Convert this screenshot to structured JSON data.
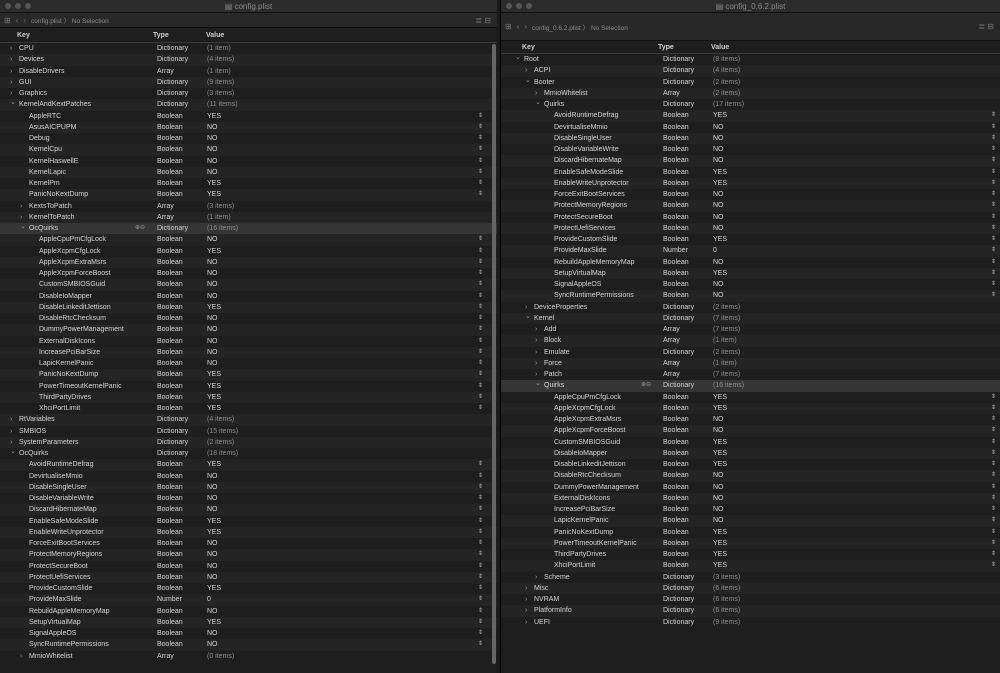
{
  "left": {
    "title": "config.plist",
    "path": "config.plist",
    "selection": "No Selection",
    "cols": {
      "key": "Key",
      "type": "Type",
      "value": "Value"
    },
    "rows": [
      {
        "i": 0,
        "c": ">",
        "k": "CPU",
        "t": "Dictionary",
        "v": "(1 item)",
        "d": 1
      },
      {
        "i": 0,
        "c": ">",
        "k": "Devices",
        "t": "Dictionary",
        "v": "(4 items)",
        "d": 1
      },
      {
        "i": 0,
        "c": ">",
        "k": "DisableDrivers",
        "t": "Array",
        "v": "(1 item)",
        "d": 1
      },
      {
        "i": 0,
        "c": ">",
        "k": "GUI",
        "t": "Dictionary",
        "v": "(9 items)",
        "d": 1
      },
      {
        "i": 0,
        "c": ">",
        "k": "Graphics",
        "t": "Dictionary",
        "v": "(3 items)",
        "d": 1
      },
      {
        "i": 0,
        "c": "v",
        "k": "KernelAndKextPatches",
        "t": "Dictionary",
        "v": "(11 items)",
        "d": 1
      },
      {
        "i": 1,
        "k": "AppleRTC",
        "t": "Boolean",
        "v": "YES",
        "s": 1
      },
      {
        "i": 1,
        "k": "AsusAICPUPM",
        "t": "Boolean",
        "v": "NO",
        "s": 1
      },
      {
        "i": 1,
        "k": "Debug",
        "t": "Boolean",
        "v": "NO",
        "s": 1
      },
      {
        "i": 1,
        "k": "KernelCpu",
        "t": "Boolean",
        "v": "NO",
        "s": 1
      },
      {
        "i": 1,
        "k": "KernelHaswellE",
        "t": "Boolean",
        "v": "NO",
        "s": 1
      },
      {
        "i": 1,
        "k": "KernelLapic",
        "t": "Boolean",
        "v": "NO",
        "s": 1
      },
      {
        "i": 1,
        "k": "KernelPm",
        "t": "Boolean",
        "v": "YES",
        "s": 1
      },
      {
        "i": 1,
        "k": "PanicNoKextDump",
        "t": "Boolean",
        "v": "YES",
        "s": 1
      },
      {
        "i": 1,
        "c": ">",
        "k": "KextsToPatch",
        "t": "Array",
        "v": "(3 items)",
        "d": 1
      },
      {
        "i": 1,
        "c": ">",
        "k": "KernelToPatch",
        "t": "Array",
        "v": "(1 item)",
        "d": 1
      },
      {
        "i": 1,
        "c": "v",
        "k": "OcQuirks",
        "t": "Dictionary",
        "v": "(16 items)",
        "d": 1,
        "sel": 1
      },
      {
        "i": 2,
        "k": "AppleCpuPmCfgLock",
        "t": "Boolean",
        "v": "NO",
        "s": 1
      },
      {
        "i": 2,
        "k": "AppleXcpmCfgLock",
        "t": "Boolean",
        "v": "YES",
        "s": 1
      },
      {
        "i": 2,
        "k": "AppleXcpmExtraMsrs",
        "t": "Boolean",
        "v": "NO",
        "s": 1
      },
      {
        "i": 2,
        "k": "AppleXcpmForceBoost",
        "t": "Boolean",
        "v": "NO",
        "s": 1
      },
      {
        "i": 2,
        "k": "CustomSMBIOSGuid",
        "t": "Boolean",
        "v": "NO",
        "s": 1
      },
      {
        "i": 2,
        "k": "DisableIoMapper",
        "t": "Boolean",
        "v": "NO",
        "s": 1
      },
      {
        "i": 2,
        "k": "DisableLinkeditJettison",
        "t": "Boolean",
        "v": "YES",
        "s": 1
      },
      {
        "i": 2,
        "k": "DisableRtcChecksum",
        "t": "Boolean",
        "v": "NO",
        "s": 1
      },
      {
        "i": 2,
        "k": "DummyPowerManagement",
        "t": "Boolean",
        "v": "NO",
        "s": 1
      },
      {
        "i": 2,
        "k": "ExternalDiskIcons",
        "t": "Boolean",
        "v": "NO",
        "s": 1
      },
      {
        "i": 2,
        "k": "IncreasePciBarSize",
        "t": "Boolean",
        "v": "NO",
        "s": 1
      },
      {
        "i": 2,
        "k": "LapicKernelPanic",
        "t": "Boolean",
        "v": "NO",
        "s": 1
      },
      {
        "i": 2,
        "k": "PanicNoKextDump",
        "t": "Boolean",
        "v": "YES",
        "s": 1
      },
      {
        "i": 2,
        "k": "PowerTimeoutKernelPanic",
        "t": "Boolean",
        "v": "YES",
        "s": 1
      },
      {
        "i": 2,
        "k": "ThirdPartyDrives",
        "t": "Boolean",
        "v": "YES",
        "s": 1
      },
      {
        "i": 2,
        "k": "XhciPortLimit",
        "t": "Boolean",
        "v": "YES",
        "s": 1
      },
      {
        "i": 0,
        "c": ">",
        "k": "RtVariables",
        "t": "Dictionary",
        "v": "(4 items)",
        "d": 1
      },
      {
        "i": 0,
        "c": ">",
        "k": "SMBIOS",
        "t": "Dictionary",
        "v": "(15 items)",
        "d": 1
      },
      {
        "i": 0,
        "c": ">",
        "k": "SystemParameters",
        "t": "Dictionary",
        "v": "(2 items)",
        "d": 1
      },
      {
        "i": 0,
        "c": "v",
        "k": "OcQuirks",
        "t": "Dictionary",
        "v": "(18 items)",
        "d": 1
      },
      {
        "i": 1,
        "k": "AvoidRuntimeDefrag",
        "t": "Boolean",
        "v": "YES",
        "s": 1
      },
      {
        "i": 1,
        "k": "DevirtualiseMmio",
        "t": "Boolean",
        "v": "NO",
        "s": 1
      },
      {
        "i": 1,
        "k": "DisableSingleUser",
        "t": "Boolean",
        "v": "NO",
        "s": 1
      },
      {
        "i": 1,
        "k": "DisableVariableWrite",
        "t": "Boolean",
        "v": "NO",
        "s": 1
      },
      {
        "i": 1,
        "k": "DiscardHibernateMap",
        "t": "Boolean",
        "v": "NO",
        "s": 1
      },
      {
        "i": 1,
        "k": "EnableSafeModeSlide",
        "t": "Boolean",
        "v": "YES",
        "s": 1
      },
      {
        "i": 1,
        "k": "EnableWriteUnprotector",
        "t": "Boolean",
        "v": "YES",
        "s": 1
      },
      {
        "i": 1,
        "k": "ForceExitBootServices",
        "t": "Boolean",
        "v": "NO",
        "s": 1
      },
      {
        "i": 1,
        "k": "ProtectMemoryRegions",
        "t": "Boolean",
        "v": "NO",
        "s": 1
      },
      {
        "i": 1,
        "k": "ProtectSecureBoot",
        "t": "Boolean",
        "v": "NO",
        "s": 1
      },
      {
        "i": 1,
        "k": "ProtectUefiServices",
        "t": "Boolean",
        "v": "NO",
        "s": 1
      },
      {
        "i": 1,
        "k": "ProvideCustomSlide",
        "t": "Boolean",
        "v": "YES",
        "s": 1
      },
      {
        "i": 1,
        "k": "ProvideMaxSlide",
        "t": "Number",
        "v": "0",
        "s": 1
      },
      {
        "i": 1,
        "k": "RebuildAppleMemoryMap",
        "t": "Boolean",
        "v": "NO",
        "s": 1
      },
      {
        "i": 1,
        "k": "SetupVirtualMap",
        "t": "Boolean",
        "v": "YES",
        "s": 1
      },
      {
        "i": 1,
        "k": "SignalAppleOS",
        "t": "Boolean",
        "v": "NO",
        "s": 1
      },
      {
        "i": 1,
        "k": "SyncRuntimePermissions",
        "t": "Boolean",
        "v": "NO",
        "s": 1
      },
      {
        "i": 1,
        "c": ">",
        "k": "MmioWhitelist",
        "t": "Array",
        "v": "(0 items)",
        "d": 1
      }
    ]
  },
  "right": {
    "title": "config_0.6.2.plist",
    "path": "config_0.6.2.plist",
    "selection": "No Selection",
    "cols": {
      "key": "Key",
      "type": "Type",
      "value": "Value"
    },
    "rows": [
      {
        "i": 0,
        "c": "v",
        "k": "Root",
        "t": "Dictionary",
        "v": "(8 items)",
        "d": 1
      },
      {
        "i": 1,
        "c": ">",
        "k": "ACPI",
        "t": "Dictionary",
        "v": "(4 items)",
        "d": 1
      },
      {
        "i": 1,
        "c": "v",
        "k": "Booter",
        "t": "Dictionary",
        "v": "(2 items)",
        "d": 1
      },
      {
        "i": 2,
        "c": ">",
        "k": "MmioWhitelist",
        "t": "Array",
        "v": "(2 items)",
        "d": 1
      },
      {
        "i": 2,
        "c": "v",
        "k": "Quirks",
        "t": "Dictionary",
        "v": "(17 items)",
        "d": 1
      },
      {
        "i": 3,
        "k": "AvoidRuntimeDefrag",
        "t": "Boolean",
        "v": "YES",
        "s": 1
      },
      {
        "i": 3,
        "k": "DevirtualiseMmio",
        "t": "Boolean",
        "v": "NO",
        "s": 1
      },
      {
        "i": 3,
        "k": "DisableSingleUser",
        "t": "Boolean",
        "v": "NO",
        "s": 1
      },
      {
        "i": 3,
        "k": "DisableVariableWrite",
        "t": "Boolean",
        "v": "NO",
        "s": 1
      },
      {
        "i": 3,
        "k": "DiscardHibernateMap",
        "t": "Boolean",
        "v": "NO",
        "s": 1
      },
      {
        "i": 3,
        "k": "EnableSafeModeSlide",
        "t": "Boolean",
        "v": "YES",
        "s": 1
      },
      {
        "i": 3,
        "k": "EnableWriteUnprotector",
        "t": "Boolean",
        "v": "YES",
        "s": 1
      },
      {
        "i": 3,
        "k": "ForceExitBootServices",
        "t": "Boolean",
        "v": "NO",
        "s": 1
      },
      {
        "i": 3,
        "k": "ProtectMemoryRegions",
        "t": "Boolean",
        "v": "NO",
        "s": 1
      },
      {
        "i": 3,
        "k": "ProtectSecureBoot",
        "t": "Boolean",
        "v": "NO",
        "s": 1
      },
      {
        "i": 3,
        "k": "ProtectUefiServices",
        "t": "Boolean",
        "v": "NO",
        "s": 1
      },
      {
        "i": 3,
        "k": "ProvideCustomSlide",
        "t": "Boolean",
        "v": "YES",
        "s": 1
      },
      {
        "i": 3,
        "k": "ProvideMaxSlide",
        "t": "Number",
        "v": "0",
        "s": 1
      },
      {
        "i": 3,
        "k": "RebuildAppleMemoryMap",
        "t": "Boolean",
        "v": "NO",
        "s": 1
      },
      {
        "i": 3,
        "k": "SetupVirtualMap",
        "t": "Boolean",
        "v": "YES",
        "s": 1
      },
      {
        "i": 3,
        "k": "SignalAppleOS",
        "t": "Boolean",
        "v": "NO",
        "s": 1
      },
      {
        "i": 3,
        "k": "SyncRuntimePermissions",
        "t": "Boolean",
        "v": "NO",
        "s": 1
      },
      {
        "i": 1,
        "c": ">",
        "k": "DeviceProperties",
        "t": "Dictionary",
        "v": "(2 items)",
        "d": 1
      },
      {
        "i": 1,
        "c": "v",
        "k": "Kernel",
        "t": "Dictionary",
        "v": "(7 items)",
        "d": 1
      },
      {
        "i": 2,
        "c": ">",
        "k": "Add",
        "t": "Array",
        "v": "(7 items)",
        "d": 1
      },
      {
        "i": 2,
        "c": ">",
        "k": "Block",
        "t": "Array",
        "v": "(1 item)",
        "d": 1
      },
      {
        "i": 2,
        "c": ">",
        "k": "Emulate",
        "t": "Dictionary",
        "v": "(2 items)",
        "d": 1
      },
      {
        "i": 2,
        "c": ">",
        "k": "Force",
        "t": "Array",
        "v": "(1 item)",
        "d": 1
      },
      {
        "i": 2,
        "c": ">",
        "k": "Patch",
        "t": "Array",
        "v": "(7 items)",
        "d": 1
      },
      {
        "i": 2,
        "c": "v",
        "k": "Quirks",
        "t": "Dictionary",
        "v": "(16 items)",
        "d": 1,
        "sel": 1
      },
      {
        "i": 3,
        "k": "AppleCpuPmCfgLock",
        "t": "Boolean",
        "v": "YES",
        "s": 1
      },
      {
        "i": 3,
        "k": "AppleXcpmCfgLock",
        "t": "Boolean",
        "v": "YES",
        "s": 1
      },
      {
        "i": 3,
        "k": "AppleXcpmExtraMsrs",
        "t": "Boolean",
        "v": "NO",
        "s": 1
      },
      {
        "i": 3,
        "k": "AppleXcpmForceBoost",
        "t": "Boolean",
        "v": "NO",
        "s": 1
      },
      {
        "i": 3,
        "k": "CustomSMBIOSGuid",
        "t": "Boolean",
        "v": "YES",
        "s": 1
      },
      {
        "i": 3,
        "k": "DisableIoMapper",
        "t": "Boolean",
        "v": "YES",
        "s": 1
      },
      {
        "i": 3,
        "k": "DisableLinkeditJettison",
        "t": "Boolean",
        "v": "YES",
        "s": 1
      },
      {
        "i": 3,
        "k": "DisableRtcChecksum",
        "t": "Boolean",
        "v": "NO",
        "s": 1
      },
      {
        "i": 3,
        "k": "DummyPowerManagement",
        "t": "Boolean",
        "v": "NO",
        "s": 1
      },
      {
        "i": 3,
        "k": "ExternalDiskIcons",
        "t": "Boolean",
        "v": "NO",
        "s": 1
      },
      {
        "i": 3,
        "k": "IncreasePciBarSize",
        "t": "Boolean",
        "v": "NO",
        "s": 1
      },
      {
        "i": 3,
        "k": "LapicKernelPanic",
        "t": "Boolean",
        "v": "NO",
        "s": 1
      },
      {
        "i": 3,
        "k": "PanicNoKextDump",
        "t": "Boolean",
        "v": "YES",
        "s": 1
      },
      {
        "i": 3,
        "k": "PowerTimeoutKernelPanic",
        "t": "Boolean",
        "v": "YES",
        "s": 1
      },
      {
        "i": 3,
        "k": "ThirdPartyDrives",
        "t": "Boolean",
        "v": "YES",
        "s": 1
      },
      {
        "i": 3,
        "k": "XhciPortLimit",
        "t": "Boolean",
        "v": "YES",
        "s": 1
      },
      {
        "i": 2,
        "c": ">",
        "k": "Scheme",
        "t": "Dictionary",
        "v": "(3 items)",
        "d": 1
      },
      {
        "i": 1,
        "c": ">",
        "k": "Misc",
        "t": "Dictionary",
        "v": "(6 items)",
        "d": 1
      },
      {
        "i": 1,
        "c": ">",
        "k": "NVRAM",
        "t": "Dictionary",
        "v": "(6 items)",
        "d": 1
      },
      {
        "i": 1,
        "c": ">",
        "k": "PlatformInfo",
        "t": "Dictionary",
        "v": "(6 items)",
        "d": 1
      },
      {
        "i": 1,
        "c": ">",
        "k": "UEFI",
        "t": "Dictionary",
        "v": "(9 items)",
        "d": 1
      }
    ]
  },
  "icons": {
    "stepper": "⇕",
    "add_remove": "⊕⊖",
    "chev_collapsed": "›",
    "chev_expanded": "⌄"
  }
}
